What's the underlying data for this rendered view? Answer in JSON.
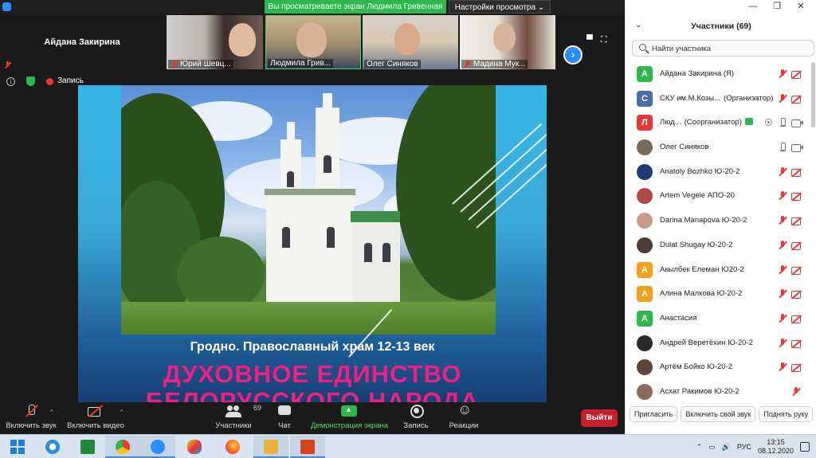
{
  "window": {
    "share_banner": "Вы просматриваете экран Людмила Гривенная",
    "view_options": "Настройки просмотра ⌄",
    "controls": [
      "—",
      "❐",
      "✕"
    ]
  },
  "thumbnails": {
    "main_name": "Айдана Закирина",
    "tiles": [
      {
        "name": "Юрий Шевц..."
      },
      {
        "name": "Людмила Грив..."
      },
      {
        "name": "Олег Синяков"
      },
      {
        "name": "Мадина Мук..."
      }
    ],
    "next_glyph": "›",
    "view_icons": [
      "▀",
      "⛶"
    ]
  },
  "meeting_info": {
    "info_glyph": "i",
    "record_label": "Запись"
  },
  "slide": {
    "caption": "Гродно. Православный храм 12-13 век",
    "title_line1": "ДУХОВНОЕ ЕДИНСТВО",
    "title_line2": "БЕЛОРУССКОГО НАРОДА"
  },
  "toolbar": {
    "audio_label": "Включить звук",
    "video_label": "Включить видео",
    "participants_label": "Участники",
    "participants_count": "69",
    "chat_label": "Чат",
    "share_label": "Демонстрация экрана",
    "record_label": "Запись",
    "reactions_label": "Реакции",
    "leave_label": "Выйти",
    "caret": "^"
  },
  "panel": {
    "collapse_glyph": "⌄",
    "title": "Участники (69)",
    "search_placeholder": "Найти участника",
    "participants": [
      {
        "name": "Айдана Закирина (Я)",
        "role": "",
        "initial": "А",
        "color": "#2db84d",
        "mic": "off",
        "cam": "off"
      },
      {
        "name": "СКУ им.М.Козы...",
        "role": "(Организатор)",
        "initial": "С",
        "color": "#4a6ea8",
        "mic": "off",
        "cam": "off"
      },
      {
        "name": "Люд...",
        "role": "(Соорганизатор)",
        "initial": "Л",
        "color": "#e53935",
        "mic": "on",
        "cam": "on"
      },
      {
        "name": "Олег Синяков",
        "role": "",
        "initial": "",
        "color": "#7a6a5a",
        "mic": "on",
        "cam": "on"
      },
      {
        "name": "Anatoly Bozhko Ю-20-2",
        "role": "",
        "initial": "",
        "color": "#1f3b73",
        "mic": "off",
        "cam": "off"
      },
      {
        "name": "Artem Vegele АПО-20",
        "role": "",
        "initial": "",
        "color": "#b04a4a",
        "mic": "off",
        "cam": "off"
      },
      {
        "name": "Darina Manapova Ю-20-2",
        "role": "",
        "initial": "",
        "color": "#c99a8a",
        "mic": "off",
        "cam": "off"
      },
      {
        "name": "Dulat Shugay Ю-20-2",
        "role": "",
        "initial": "",
        "color": "#4e3b34",
        "mic": "off",
        "cam": "off"
      },
      {
        "name": "Акылбек Елеман Ю20-2",
        "role": "",
        "initial": "А",
        "color": "#f5a01a",
        "mic": "off",
        "cam": "off"
      },
      {
        "name": "Алина Малкова Ю-20-2",
        "role": "",
        "initial": "А",
        "color": "#f5a01a",
        "mic": "off",
        "cam": "off"
      },
      {
        "name": "Анастасия",
        "role": "",
        "initial": "А",
        "color": "#2db84d",
        "mic": "off",
        "cam": "off"
      },
      {
        "name": "Андрей Веретёхин Ю-20-2",
        "role": "",
        "initial": "",
        "color": "#2a2a2a",
        "mic": "off",
        "cam": "off"
      },
      {
        "name": "Артём Бойко Ю-20-2",
        "role": "",
        "initial": "",
        "color": "#5a4638",
        "mic": "off",
        "cam": "off"
      },
      {
        "name": "Асхат Ракимов Ю-20-2",
        "role": "",
        "initial": "",
        "color": "#8a6a5a",
        "mic": "off",
        "cam": "none"
      }
    ],
    "footer": {
      "invite": "Пригласить",
      "unmute": "Включить свой звук",
      "raise_hand": "Поднять руку"
    }
  },
  "taskbar": {
    "language": "РУС",
    "time": "13:15",
    "date": "08.12.2020",
    "tray_icons": [
      "⌃",
      "▭",
      "🔊"
    ]
  }
}
